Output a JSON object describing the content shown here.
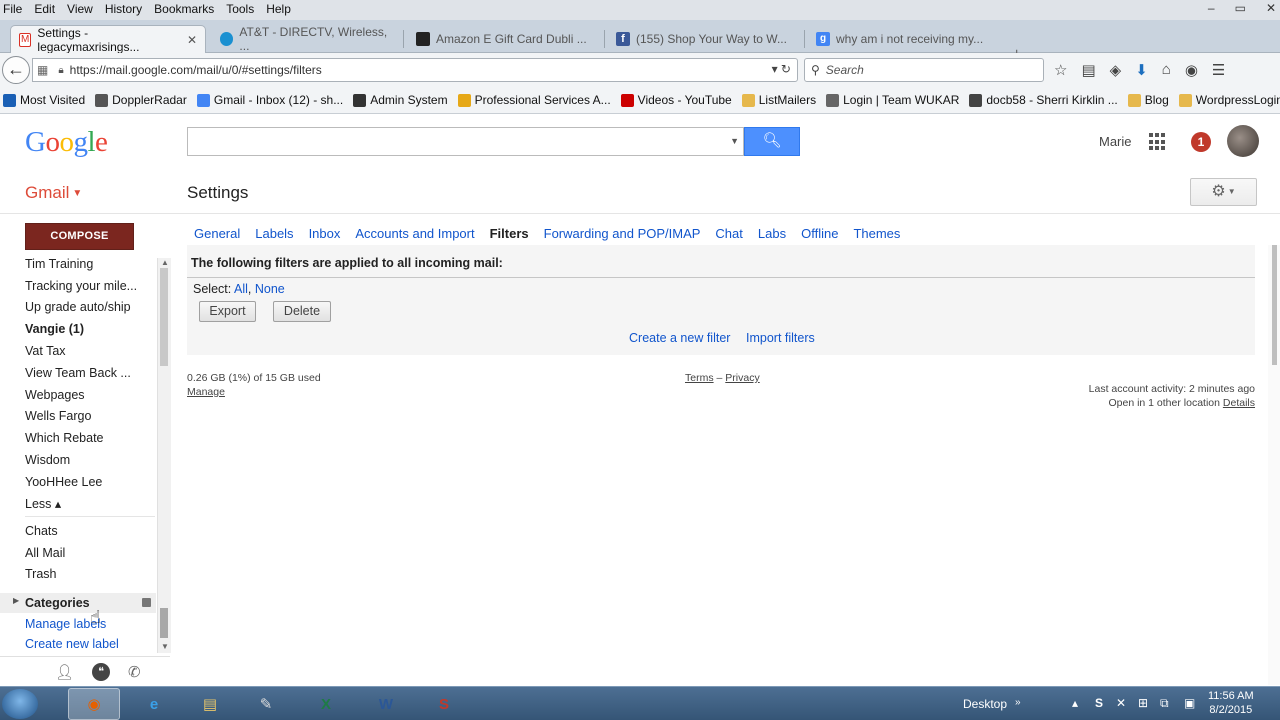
{
  "browser": {
    "menu": [
      "File",
      "Edit",
      "View",
      "History",
      "Bookmarks",
      "Tools",
      "Help"
    ],
    "window_controls": [
      "–",
      "▭",
      "✕"
    ],
    "tabs": [
      {
        "label": "Settings - legacymaxrisings...",
        "favicon_color": "#d93025",
        "active": true
      },
      {
        "label": "AT&T - DIRECTV, Wireless, ...",
        "favicon_color": "#1a90d1",
        "active": false
      },
      {
        "label": "Amazon E Gift Card Dubli ...",
        "favicon_color": "#222222",
        "active": false
      },
      {
        "label": "(155) Shop Your Way to W...",
        "favicon_color": "#3b5998",
        "active": false
      },
      {
        "label": "why am i not receiving my...",
        "favicon_color": "#4285f4",
        "active": false
      }
    ],
    "new_tab": "+",
    "url": "https://mail.google.com/mail/u/0/#settings/filters",
    "search_placeholder": "Search",
    "bookmarks": [
      {
        "label": "Most Visited",
        "color": "#1a5fb4"
      },
      {
        "label": "DopplerRadar",
        "color": "#555555"
      },
      {
        "label": "Gmail - Inbox (12) - sh...",
        "color": "#4285f4"
      },
      {
        "label": "Admin System",
        "color": "#333333"
      },
      {
        "label": "Professional Services A...",
        "color": "#e6a817"
      },
      {
        "label": "Videos - YouTube",
        "color": "#cc0000"
      },
      {
        "label": "ListMailers",
        "color": "#e6b84c"
      },
      {
        "label": "Login | Team WUKAR",
        "color": "#666666"
      },
      {
        "label": "docb58 - Sherri Kirklin ...",
        "color": "#444444"
      },
      {
        "label": "Blog",
        "color": "#e6b84c"
      },
      {
        "label": "WordpressLogin",
        "color": "#e6b84c"
      }
    ]
  },
  "gmail": {
    "logo": [
      {
        "ch": "G",
        "color": "#4285f4"
      },
      {
        "ch": "o",
        "color": "#ea4335"
      },
      {
        "ch": "o",
        "color": "#fbbc05"
      },
      {
        "ch": "g",
        "color": "#4285f4"
      },
      {
        "ch": "l",
        "color": "#34a853"
      },
      {
        "ch": "e",
        "color": "#ea4335"
      }
    ],
    "user_name": "Marie",
    "notification_count": "1",
    "app_label": "Gmail",
    "page_title": "Settings",
    "compose_label": "COMPOSE",
    "sidebar_items": [
      {
        "label": "Tim Training",
        "style": "normal"
      },
      {
        "label": "Tracking your mile...",
        "style": "normal"
      },
      {
        "label": "Up grade auto/ship",
        "style": "normal"
      },
      {
        "label": "Vangie (1)",
        "style": "bold"
      },
      {
        "label": "Vat Tax",
        "style": "normal"
      },
      {
        "label": "View Team Back ...",
        "style": "normal"
      },
      {
        "label": "Webpages",
        "style": "normal"
      },
      {
        "label": "Wells Fargo",
        "style": "normal"
      },
      {
        "label": "Which Rebate",
        "style": "normal"
      },
      {
        "label": "Wisdom",
        "style": "normal"
      },
      {
        "label": "YooHHee Lee",
        "style": "normal"
      },
      {
        "label": "Less ▴",
        "style": "normal"
      },
      {
        "label": "Chats",
        "style": "normal"
      },
      {
        "label": "All Mail",
        "style": "normal"
      },
      {
        "label": "Trash",
        "style": "normal"
      },
      {
        "label": "Categories",
        "style": "bold"
      },
      {
        "label": "Manage labels",
        "style": "link"
      },
      {
        "label": "Create new label",
        "style": "link"
      }
    ],
    "settings_tabs": [
      {
        "label": "General",
        "current": false
      },
      {
        "label": "Labels",
        "current": false
      },
      {
        "label": "Inbox",
        "current": false
      },
      {
        "label": "Accounts and Import",
        "current": false
      },
      {
        "label": "Filters",
        "current": true
      },
      {
        "label": "Forwarding and POP/IMAP",
        "current": false
      },
      {
        "label": "Chat",
        "current": false
      },
      {
        "label": "Labs",
        "current": false
      },
      {
        "label": "Offline",
        "current": false
      },
      {
        "label": "Themes",
        "current": false
      }
    ],
    "filters": {
      "header": "The following filters are applied to all incoming mail:",
      "select_label": "Select:",
      "select_all": "All",
      "select_none": "None",
      "export_label": "Export",
      "delete_label": "Delete",
      "create_filter": "Create a new filter",
      "import_filters": "Import filters"
    },
    "footer": {
      "storage": "0.26 GB (1%) of 15 GB used",
      "manage": "Manage",
      "terms": "Terms",
      "privacy": "Privacy",
      "last_activity": "Last account activity: 2 minutes ago",
      "other_location": "Open in 1 other location",
      "details": "Details"
    }
  },
  "taskbar": {
    "desktop_label": "Desktop",
    "clock_time": "11:56 AM",
    "clock_date": "8/2/2015",
    "apps": [
      {
        "name": "firefox",
        "glyph": "◉",
        "color": "#e66000",
        "active": true
      },
      {
        "name": "internet-explorer",
        "glyph": "e",
        "color": "#3aa0e8",
        "active": false
      },
      {
        "name": "file-explorer",
        "glyph": "▤",
        "color": "#e8c66a",
        "active": false
      },
      {
        "name": "app-utility",
        "glyph": "✎",
        "color": "#dddddd",
        "active": false
      },
      {
        "name": "excel",
        "glyph": "X",
        "color": "#1e7b45",
        "active": false
      },
      {
        "name": "word",
        "glyph": "W",
        "color": "#2b5797",
        "active": false
      },
      {
        "name": "screencast",
        "glyph": "S",
        "color": "#c0392b",
        "active": false
      }
    ]
  }
}
